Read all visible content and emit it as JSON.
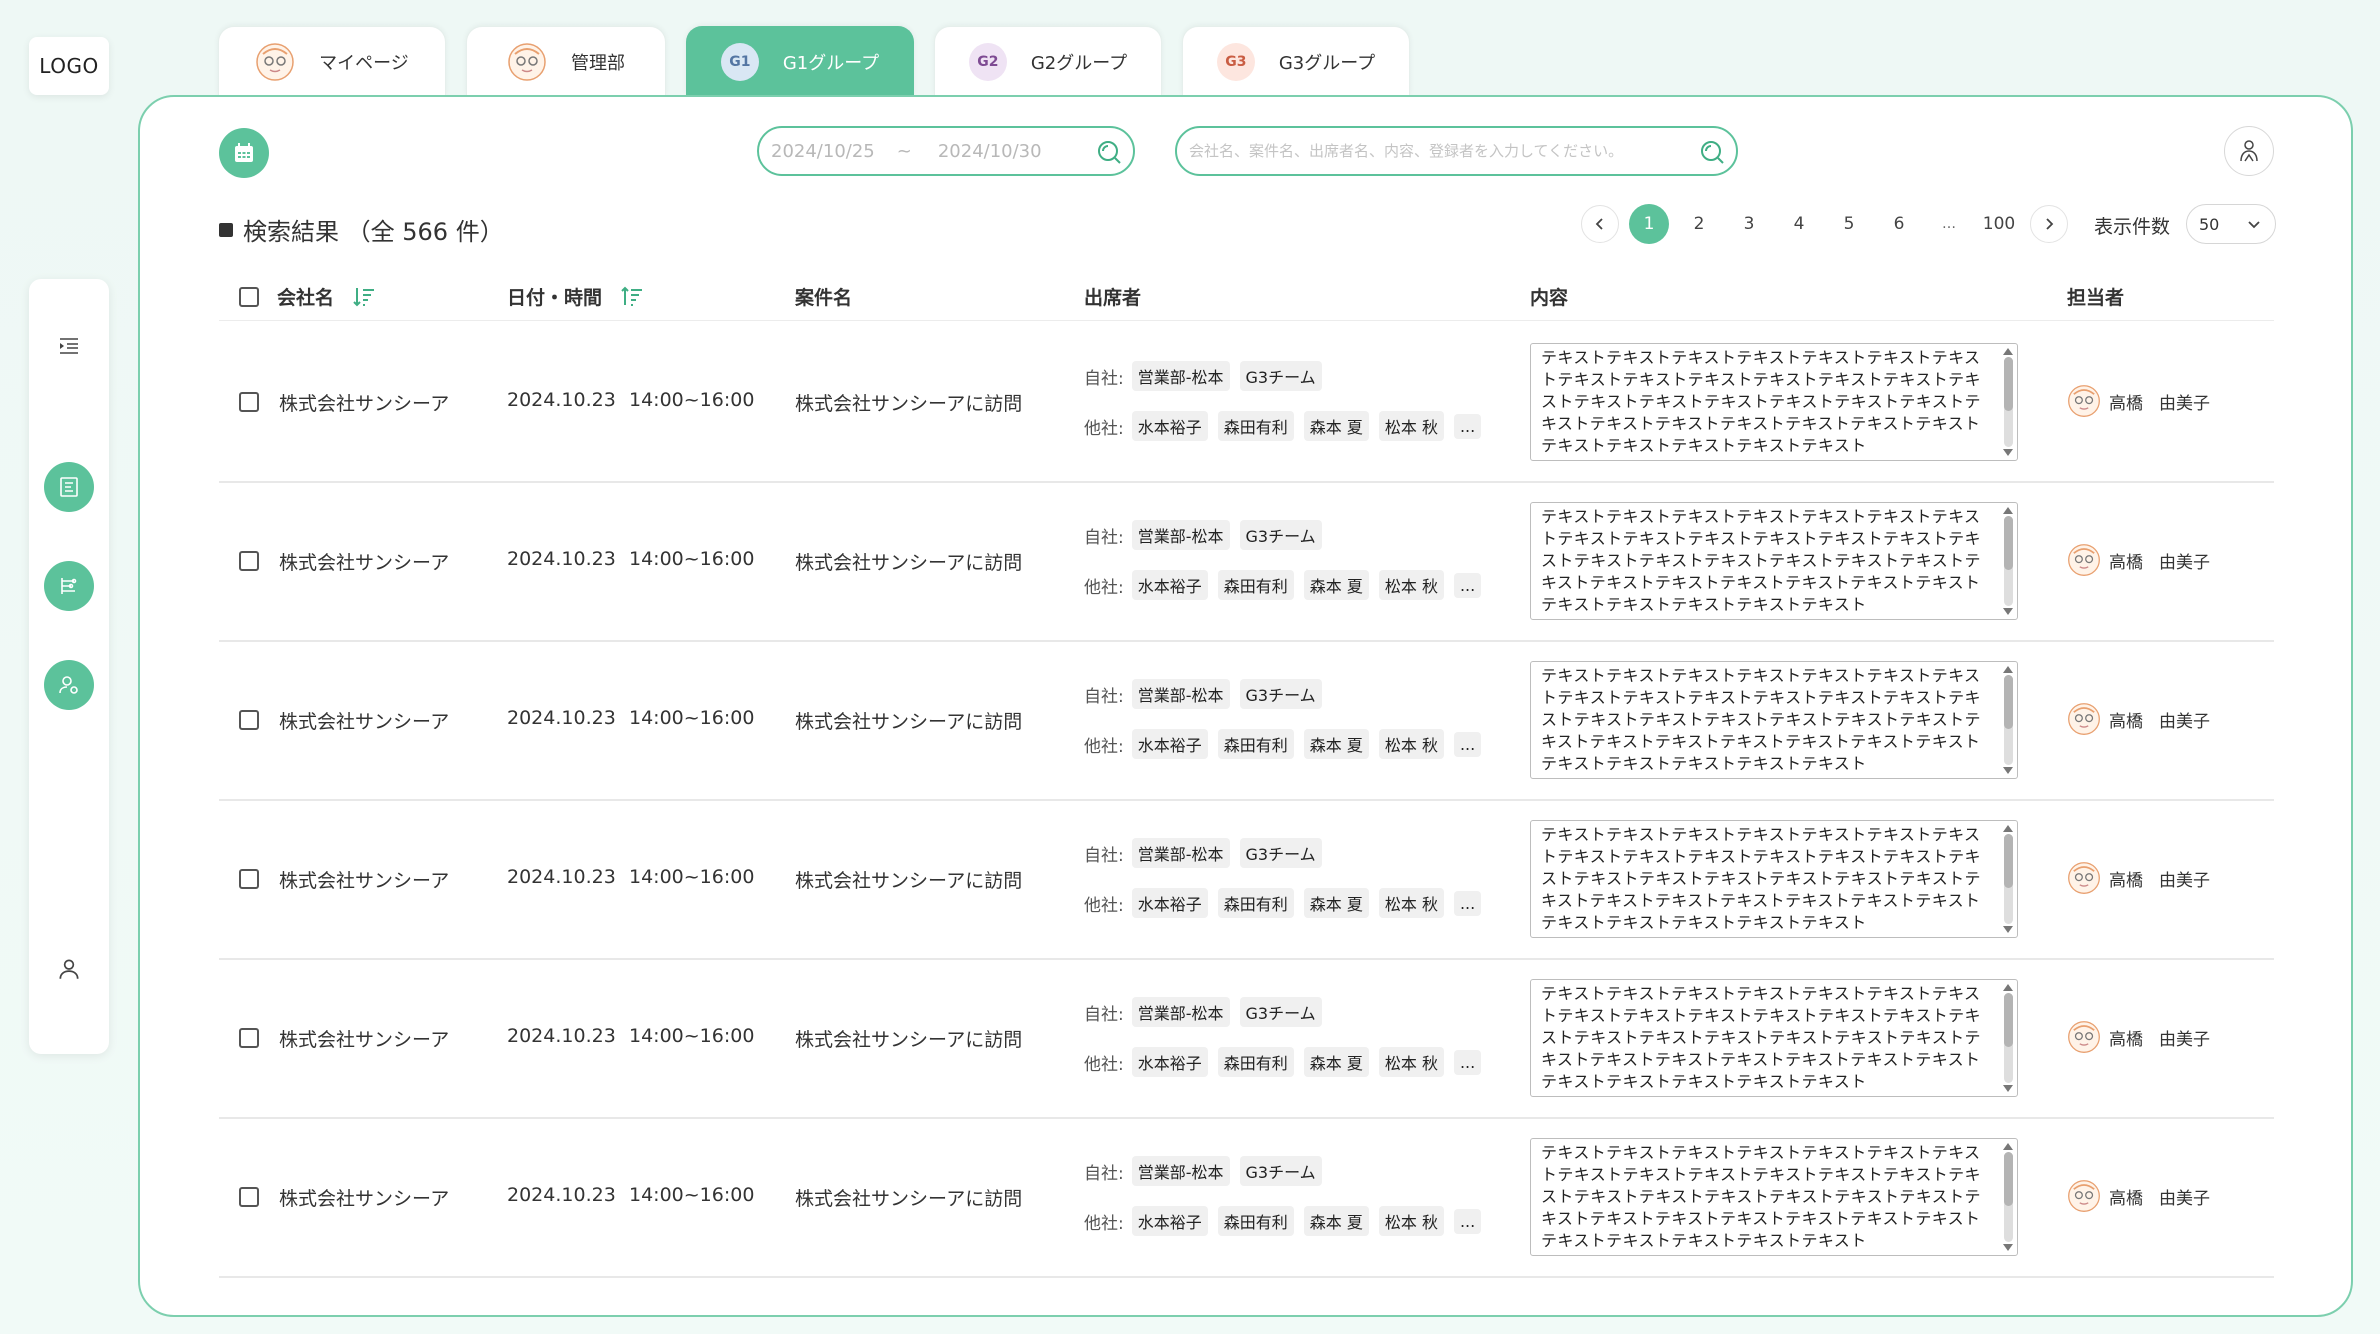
{
  "logo": "LOGO",
  "tabs": [
    {
      "label": "マイページ",
      "icon": "avatar-icon"
    },
    {
      "label": "管理部",
      "icon": "avatar-icon"
    },
    {
      "label": "G1グループ",
      "badge": "G1",
      "active": true
    },
    {
      "label": "G2グループ",
      "badge": "G2"
    },
    {
      "label": "G3グループ",
      "badge": "G3"
    }
  ],
  "search": {
    "date_from": "2024/10/25",
    "date_sep": "~",
    "date_to": "2024/10/30",
    "keyword_placeholder": "会社名、案件名、出席者名、内容、登録者を入力してください。"
  },
  "results": {
    "title": "検索結果 （全 566 件）"
  },
  "pagination": {
    "pages": [
      "1",
      "2",
      "3",
      "4",
      "5",
      "6",
      "…",
      "100"
    ],
    "current": "1",
    "per_page_label": "表示件数",
    "per_page_value": "50"
  },
  "table": {
    "headers": {
      "company": "会社名",
      "datetime": "日付・時間",
      "project": "案件名",
      "attendees": "出席者",
      "content": "内容",
      "owner": "担当者"
    },
    "rows": [
      {
        "company": "株式会社サンシーア",
        "date": "2024.10.23",
        "time": "14:00~16:00",
        "project": "株式会社サンシーアに訪問",
        "own_label": "自社:",
        "own": [
          "営業部-松本",
          "G3チーム"
        ],
        "other_label": "他社:",
        "other": [
          "水本裕子",
          "森田有利",
          "森本 夏",
          "松本 秋",
          "..."
        ],
        "content": "テキストテキストテキストテキストテキストテキストテキストテキストテキストテキストテキストテキストテキストテキストテキストテキストテキストテキストテキストテキストテキストテキストテキストテキストテキストテキストテキストテキストテキストテキストテキストテキスト",
        "owner_last": "高橋",
        "owner_first": "由美子"
      },
      {
        "company": "株式会社サンシーア",
        "date": "2024.10.23",
        "time": "14:00~16:00",
        "project": "株式会社サンシーアに訪問",
        "own_label": "自社:",
        "own": [
          "営業部-松本",
          "G3チーム"
        ],
        "other_label": "他社:",
        "other": [
          "水本裕子",
          "森田有利",
          "森本 夏",
          "松本 秋",
          "..."
        ],
        "content": "テキストテキストテキストテキストテキストテキストテキストテキストテキストテキストテキストテキストテキストテキストテキストテキストテキストテキストテキストテキストテキストテキストテキストテキストテキストテキストテキストテキストテキストテキストテキストテキスト",
        "owner_last": "高橋",
        "owner_first": "由美子"
      },
      {
        "company": "株式会社サンシーア",
        "date": "2024.10.23",
        "time": "14:00~16:00",
        "project": "株式会社サンシーアに訪問",
        "own_label": "自社:",
        "own": [
          "営業部-松本",
          "G3チーム"
        ],
        "other_label": "他社:",
        "other": [
          "水本裕子",
          "森田有利",
          "森本 夏",
          "松本 秋",
          "..."
        ],
        "content": "テキストテキストテキストテキストテキストテキストテキストテキストテキストテキストテキストテキストテキストテキストテキストテキストテキストテキストテキストテキストテキストテキストテキストテキストテキストテキストテキストテキストテキストテキストテキストテキスト",
        "owner_last": "高橋",
        "owner_first": "由美子"
      },
      {
        "company": "株式会社サンシーア",
        "date": "2024.10.23",
        "time": "14:00~16:00",
        "project": "株式会社サンシーアに訪問",
        "own_label": "自社:",
        "own": [
          "営業部-松本",
          "G3チーム"
        ],
        "other_label": "他社:",
        "other": [
          "水本裕子",
          "森田有利",
          "森本 夏",
          "松本 秋",
          "..."
        ],
        "content": "テキストテキストテキストテキストテキストテキストテキストテキストテキストテキストテキストテキストテキストテキストテキストテキストテキストテキストテキストテキストテキストテキストテキストテキストテキストテキストテキストテキストテキストテキストテキストテキスト",
        "owner_last": "高橋",
        "owner_first": "由美子"
      },
      {
        "company": "株式会社サンシーア",
        "date": "2024.10.23",
        "time": "14:00~16:00",
        "project": "株式会社サンシーアに訪問",
        "own_label": "自社:",
        "own": [
          "営業部-松本",
          "G3チーム"
        ],
        "other_label": "他社:",
        "other": [
          "水本裕子",
          "森田有利",
          "森本 夏",
          "松本 秋",
          "..."
        ],
        "content": "テキストテキストテキストテキストテキストテキストテキストテキストテキストテキストテキストテキストテキストテキストテキストテキストテキストテキストテキストテキストテキストテキストテキストテキストテキストテキストテキストテキストテキストテキストテキストテキスト",
        "owner_last": "高橋",
        "owner_first": "由美子"
      },
      {
        "company": "株式会社サンシーア",
        "date": "2024.10.23",
        "time": "14:00~16:00",
        "project": "株式会社サンシーアに訪問",
        "own_label": "自社:",
        "own": [
          "営業部-松本",
          "G3チーム"
        ],
        "other_label": "他社:",
        "other": [
          "水本裕子",
          "森田有利",
          "森本 夏",
          "松本 秋",
          "..."
        ],
        "content": "テキストテキストテキストテキストテキストテキストテキストテキストテキストテキストテキストテキストテキストテキストテキストテキストテキストテキストテキストテキストテキストテキストテキストテキストテキストテキストテキストテキストテキストテキストテキストテキスト",
        "owner_last": "高橋",
        "owner_first": "由美子"
      }
    ]
  },
  "colors": {
    "accent": "#5cc29b",
    "border": "#7ccfae",
    "background": "#eef8f5"
  },
  "sidebar": {
    "icons": [
      "indent-icon",
      "list-icon",
      "filter-list-icon",
      "user-settings-icon",
      "user-icon"
    ]
  }
}
